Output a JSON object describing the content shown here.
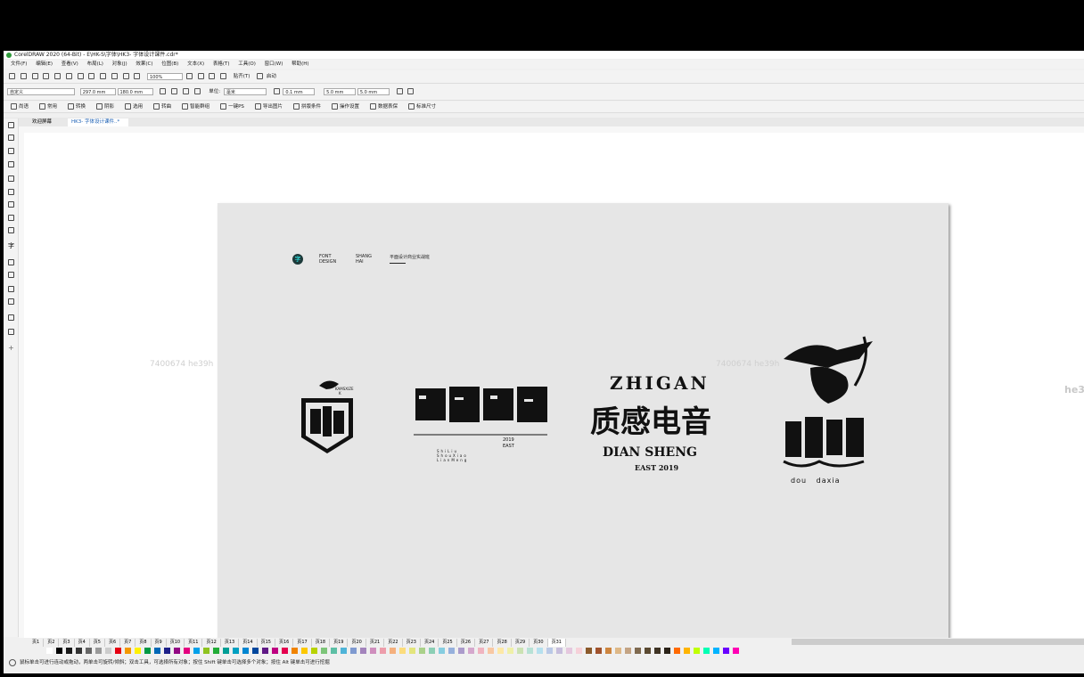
{
  "window": {
    "title": "CorelDRAW 2020 (64-Bit) - E\\HK-S\\字体\\HK3- 字体设计课件.cdr*"
  },
  "menu": [
    "文件(F)",
    "编辑(E)",
    "查看(V)",
    "布局(L)",
    "对象(J)",
    "效果(C)",
    "位图(B)",
    "文本(X)",
    "表格(T)",
    "工具(O)",
    "窗口(W)",
    "帮助(H)"
  ],
  "toolbar1": {
    "zoom": "100%",
    "snap_label": "贴齐(T)",
    "launch_label": "启动"
  },
  "property_bar": {
    "paper_preset": "自定义",
    "width": "297.0 mm",
    "height": "180.0 mm",
    "units_label": "单位:",
    "units_value": "毫米",
    "nudge": "0.1 mm",
    "dup_x": "5.0 mm",
    "dup_y": "5.0 mm"
  },
  "plugin_bar": [
    "尚语",
    "常用",
    "转换",
    "阴影",
    "选用",
    "转曲",
    "智能群组",
    "一键PS",
    "导出图片",
    "拼版条件",
    "操作设置",
    "数据表保",
    "标准尺寸"
  ],
  "doc_tabs": {
    "home": "欢迎屏幕",
    "doc": "HK3- 字体设计课件..*"
  },
  "page_header": {
    "badge": "字",
    "font_design": "FONT\nDESIGN",
    "location": "SHANG\nHAI",
    "subtitle": "平面设计商业实战班"
  },
  "logos": {
    "logo1_small": "KAMSXIZE",
    "logo2_year": "2019",
    "logo2_east": "EAST",
    "logo2_lines": "ShiLiu\nShouXiao\nLianMeng",
    "logo3_top": "ZHIGAN",
    "logo3_middle": "质感电音",
    "logo3_bottom": "DIAN SHENG",
    "logo3_year": "EAST 2019",
    "logo4_name": "dou   daxia"
  },
  "watermarks": [
    "7400674 he39h",
    "7400674 he39h",
    "he3"
  ],
  "page_tabs": [
    "页1",
    "页2",
    "页3",
    "页4",
    "页5",
    "页6",
    "页7",
    "页8",
    "页9",
    "页10",
    "页11",
    "页12",
    "页13",
    "页14",
    "页15",
    "页16",
    "页17",
    "页18",
    "页19",
    "页20",
    "页21",
    "页22",
    "页23",
    "页24",
    "页25",
    "页26",
    "页27",
    "页28",
    "页29",
    "页30",
    "页31"
  ],
  "status": "鼠标单击可进行连动或拖动，两单击可旋转/倾斜；双击工具，可选择所有对象；按住 Shift 键单击可选择多个对象；按住 Alt 键单击可进行挖掘",
  "palette": [
    "#ffffff",
    "#000000",
    "#1a1a1a",
    "#333333",
    "#666666",
    "#999999",
    "#cccccc",
    "#e60012",
    "#f39800",
    "#fff100",
    "#009944",
    "#0068b7",
    "#1d2088",
    "#920783",
    "#e4007f",
    "#00a0e9",
    "#8fc31f",
    "#22ac38",
    "#009e96",
    "#00a0c1",
    "#0086d1",
    "#00479d",
    "#601986",
    "#be0081",
    "#e5004f",
    "#f08300",
    "#fcc800",
    "#b8d200",
    "#7dc579",
    "#5dbfa5",
    "#4fb4d8",
    "#7f9ad0",
    "#a384bc",
    "#cf8ebd",
    "#ed9dab",
    "#f5b07e",
    "#fcdc7c",
    "#e3e57c",
    "#aad18a",
    "#8ccfb5",
    "#86cde0",
    "#96b0dc",
    "#ab9bcb",
    "#d5a8cd",
    "#f0b4c0",
    "#f8c8a3",
    "#fde8a6",
    "#eff0a8",
    "#cbe2b3",
    "#b7e1d5",
    "#b6e0ee",
    "#bac9e6",
    "#c7bedc",
    "#e5c8de",
    "#f6d1d9",
    "#8b5a2b",
    "#a0522d",
    "#cd853f",
    "#deb887",
    "#c4a484",
    "#7f6a50",
    "#5b4a32",
    "#3f3324",
    "#2a2218",
    "#ff6a00",
    "#ffb400",
    "#c0ff00",
    "#00ffb4",
    "#00b4ff",
    "#6a00ff",
    "#ff00b4"
  ]
}
